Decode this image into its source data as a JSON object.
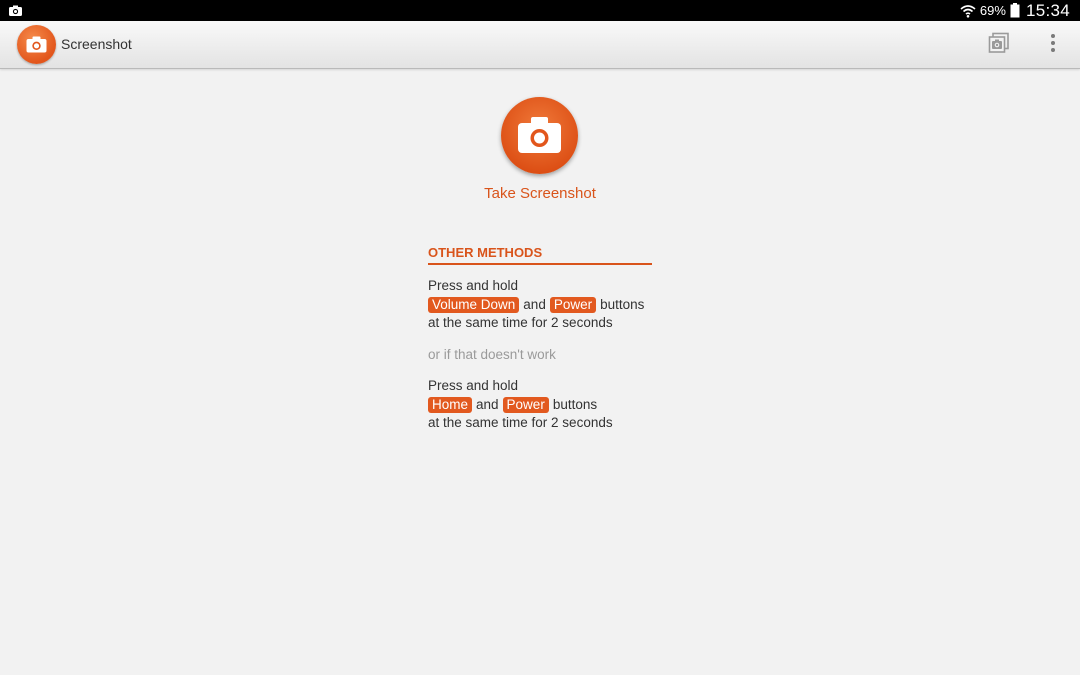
{
  "status_bar": {
    "notification_icon": "camera-icon",
    "battery_percent": "69%",
    "time": "15:34"
  },
  "action_bar": {
    "app_icon": "camera-icon",
    "title": "Screenshot",
    "gallery_icon": "screenshot-gallery-icon",
    "overflow_icon": "overflow-menu-icon"
  },
  "main": {
    "capture_button_icon": "camera-icon",
    "capture_label": "Take Screenshot",
    "section_title": "OTHER METHODS",
    "method1": {
      "line1": "Press and hold",
      "key1": "Volume Down",
      "and": "and",
      "key2": "Power",
      "buttons": "buttons",
      "line3": "at the same time for 2 seconds"
    },
    "separator": "or if that doesn't work",
    "method2": {
      "line1": "Press and hold",
      "key1": "Home",
      "and": "and",
      "key2": "Power",
      "buttons": "buttons",
      "line3": "at the same time for 2 seconds"
    }
  },
  "colors": {
    "accent": "#e2591f",
    "background": "#f2f2f2",
    "status_bar": "#000000"
  }
}
